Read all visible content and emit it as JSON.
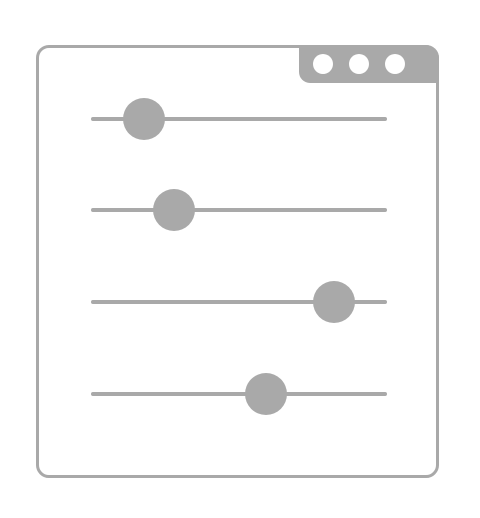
{
  "sliders": [
    {
      "name": "slider-1",
      "value": 0.18
    },
    {
      "name": "slider-2",
      "value": 0.28
    },
    {
      "name": "slider-3",
      "value": 0.82
    },
    {
      "name": "slider-4",
      "value": 0.59
    }
  ],
  "icons": {
    "main": "sliders-window-icon",
    "window_controls": [
      "window-dot-icon",
      "window-dot-icon",
      "window-dot-icon"
    ]
  },
  "colors": {
    "stroke": "#a9a9a9",
    "background": "#ffffff"
  }
}
